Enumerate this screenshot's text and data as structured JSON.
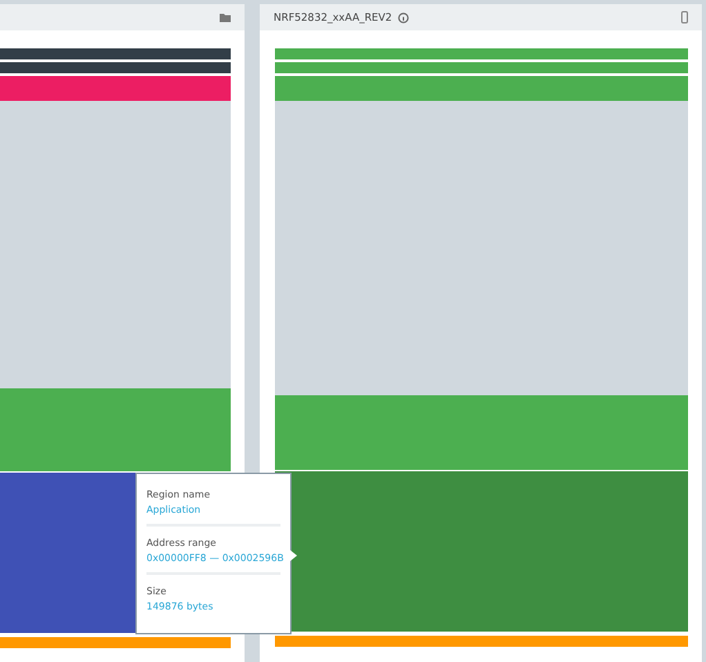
{
  "panels": [
    {
      "kind": "folder",
      "regions": [
        {
          "color": "#323e48"
        },
        {
          "color": "#323e48"
        },
        {
          "color": "#ec1e63"
        },
        {
          "color": "#d0d8de"
        },
        {
          "color": "#4caf50"
        },
        {
          "color": "#3f51b5"
        },
        {
          "color": "#ff9800"
        }
      ]
    },
    {
      "title": "NRF52832_xxAA_REV2",
      "kind": "device",
      "regions": [
        {
          "color": "#4caf50"
        },
        {
          "color": "#4caf50"
        },
        {
          "color": "#4caf50"
        },
        {
          "color": "#d0d8de"
        },
        {
          "color": "#4caf50"
        },
        {
          "color": "#3e8e41"
        },
        {
          "color": "#ff9800"
        }
      ]
    }
  ],
  "tooltip": {
    "fields": [
      {
        "label": "Region name",
        "value": "Application"
      },
      {
        "label": "Address range",
        "value": "0x00000FF8 — 0x0002596B"
      },
      {
        "label": "Size",
        "value": "149876 bytes"
      }
    ]
  }
}
